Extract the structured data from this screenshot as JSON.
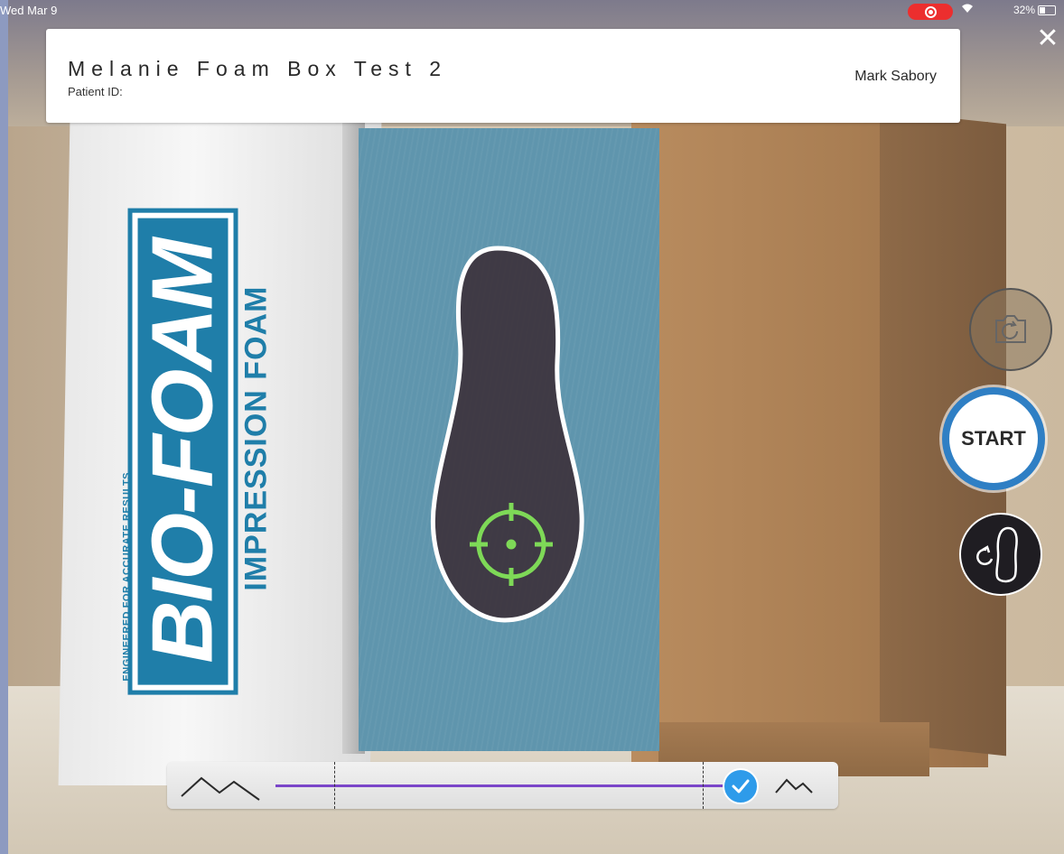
{
  "status_bar": {
    "date": "Wed Mar 9",
    "battery": "32%"
  },
  "header": {
    "patient_name": "Melanie Foam Box Test 2",
    "patient_id_label": "Patient ID:",
    "clinician": "Mark Sabory"
  },
  "scene": {
    "box_tagline": "ENGINEERED FOR ACCURATE RESULTS",
    "box_brand": "BIO-FOAM",
    "box_subtitle": "IMPRESSION FOAM"
  },
  "controls": {
    "start_label": "START"
  },
  "colors": {
    "accent_blue": "#2f7fc4",
    "reticle_green": "#7ed957",
    "slider_track": "#7b46c9",
    "slider_thumb": "#2e9bea",
    "record_red": "#ec2e2e"
  },
  "icons": {
    "close": "close-icon",
    "camera": "camera-rotate-icon",
    "flip_foot": "flip-foot-icon",
    "reticle": "crosshair-icon",
    "depth_low": "mountain-low-icon",
    "depth_high": "mountain-high-icon",
    "check": "checkmark-icon"
  }
}
